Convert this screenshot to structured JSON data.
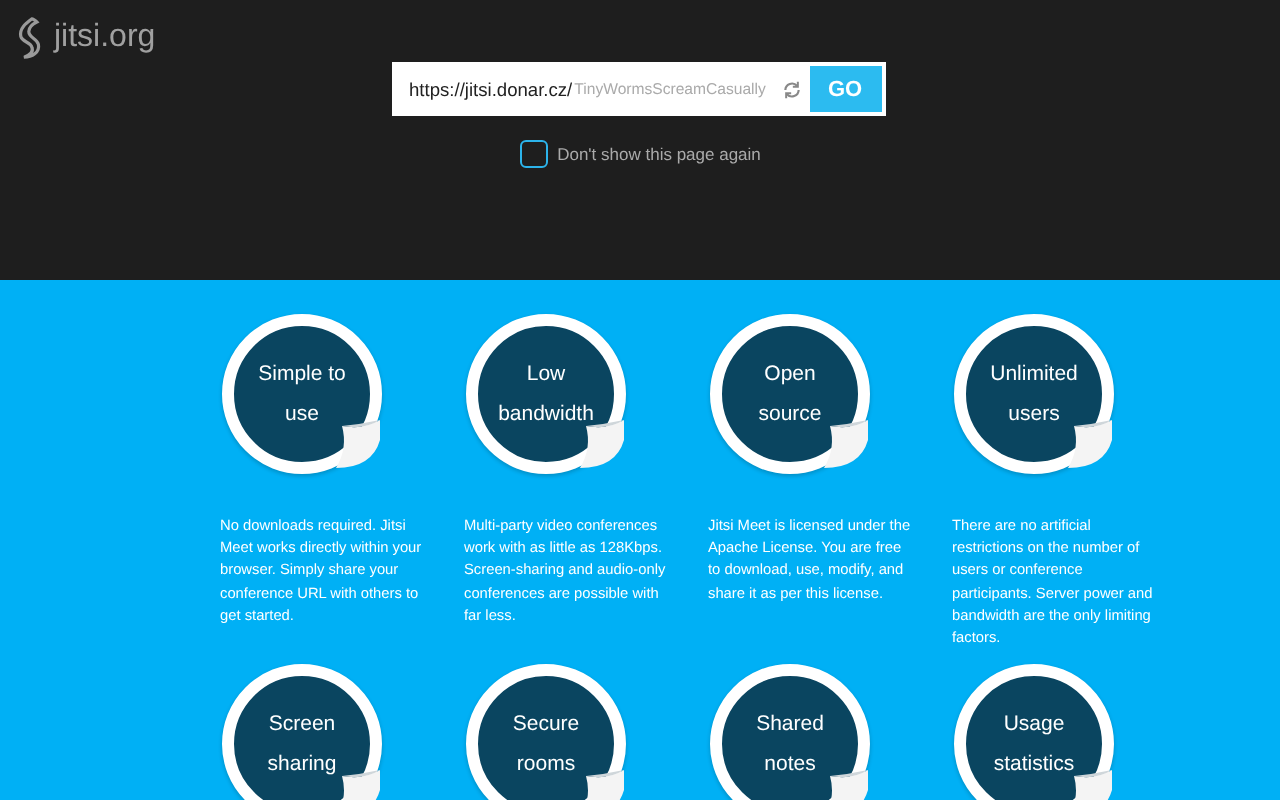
{
  "logo": {
    "text": "jitsi.org"
  },
  "room_field": {
    "prefix": "https://jitsi.donar.cz/",
    "placeholder": "TinyWormsScreamCasually"
  },
  "go_button": {
    "label": "GO"
  },
  "dont_show": {
    "label": "Don't show this page again",
    "checked": false
  },
  "features": [
    {
      "title": "Simple to use",
      "description": "No downloads required. Jitsi Meet works directly within your browser. Simply share your conference URL with others to get started."
    },
    {
      "title": "Low bandwidth",
      "description": "Multi-party video conferences work with as little as 128Kbps. Screen-sharing and audio-only conferences are possible with far less."
    },
    {
      "title": "Open source",
      "description": "Jitsi Meet is licensed under the Apache License. You are free to download, use, modify, and share it as per this license."
    },
    {
      "title": "Unlimited users",
      "description": "There are no artificial restrictions on the number of users or conference participants. Server power and bandwidth are the only limiting factors."
    },
    {
      "title": "Screen sharing"
    },
    {
      "title": "Secure rooms"
    },
    {
      "title": "Shared notes"
    },
    {
      "title": "Usage statistics"
    }
  ]
}
